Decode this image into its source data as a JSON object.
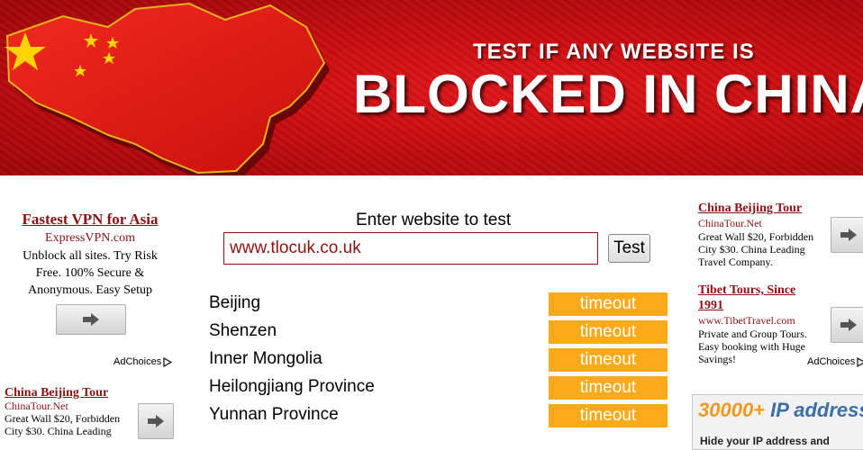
{
  "banner": {
    "headline_small": "TEST IF ANY WEBSITE IS",
    "headline_big": "BLOCKED IN CHINA"
  },
  "left_ad": {
    "title": "Fastest VPN for Asia",
    "url": "ExpressVPN.com",
    "desc_line1": "Unblock all sites. Try Risk",
    "desc_line2": "Free. 100% Secure &",
    "desc_line3": "Anonymous. Easy Setup",
    "adchoices": "AdChoices"
  },
  "left_ad2": {
    "title": "China Beijing Tour",
    "url": "ChinaTour.Net",
    "desc_line1": "Great Wall $20, Forbidden",
    "desc_line2": "City $30. China Leading"
  },
  "form": {
    "label": "Enter website to test",
    "input_value": "www.tlocuk.co.uk",
    "button_label": "Test"
  },
  "results": [
    {
      "location": "Beijing",
      "status": "timeout"
    },
    {
      "location": "Shenzen",
      "status": "timeout"
    },
    {
      "location": "Inner Mongolia",
      "status": "timeout"
    },
    {
      "location": "Heilongjiang Province",
      "status": "timeout"
    },
    {
      "location": "Yunnan Province",
      "status": "timeout"
    }
  ],
  "right_ads": [
    {
      "title": "China Beijing Tour",
      "url": "ChinaTour.Net",
      "desc_line1": "Great Wall $20, Forbidden",
      "desc_line2": "City $30. China Leading",
      "desc_line3": "Travel Company."
    },
    {
      "title_line1": "Tibet Tours, Since",
      "title_line2": "1991",
      "url": "www.TibetTravel.com",
      "desc_line1": "Private and Group Tours.",
      "desc_line2": "Easy booking with Huge",
      "desc_line3": "Savings!"
    }
  ],
  "right_adchoices": "AdChoices",
  "ip_box": {
    "number": "30000+",
    "text": "IP addresses",
    "sub": "Hide your IP address and"
  },
  "colors": {
    "banner_red": "#c80c10",
    "ad_link": "#8b1212",
    "status_orange": "#fdaa1a"
  },
  "icons": [
    "arrow-right-icon",
    "adchoices-icon",
    "star-icon"
  ]
}
